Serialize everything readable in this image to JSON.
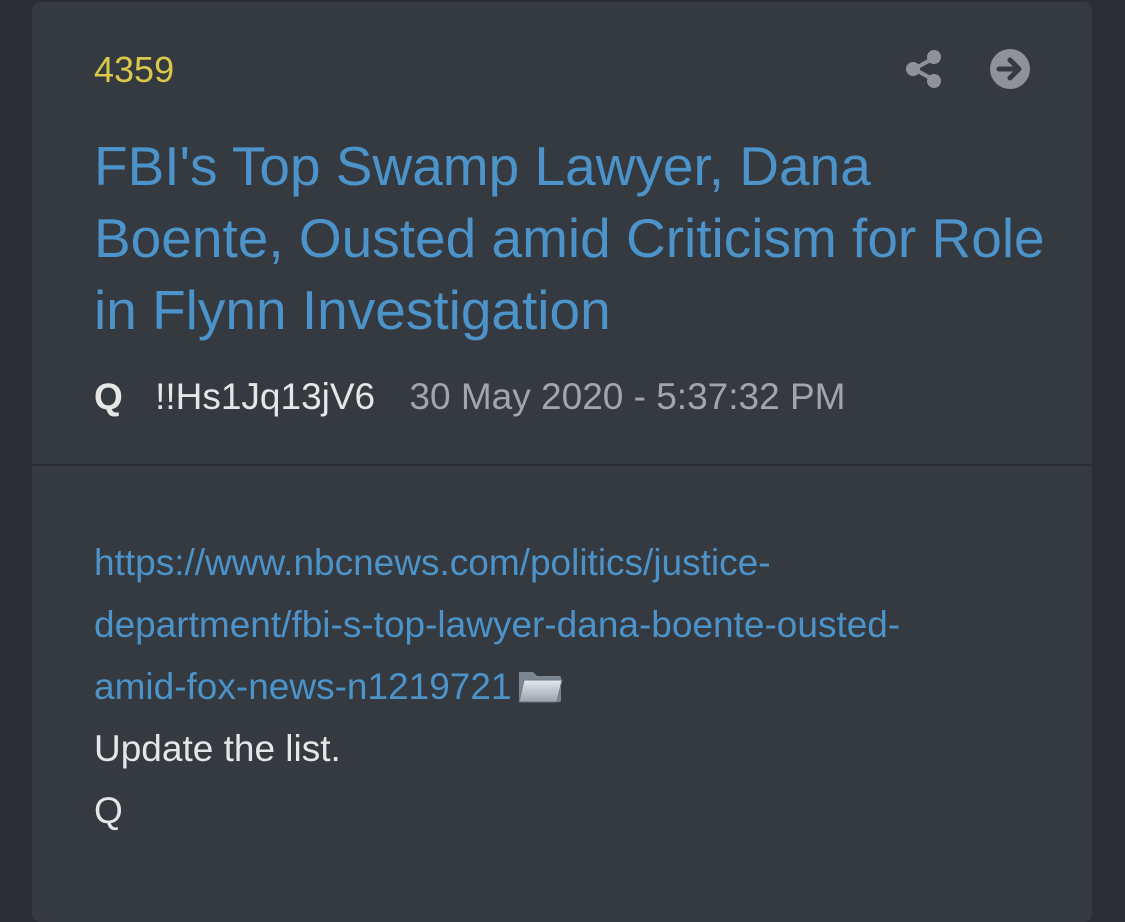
{
  "post": {
    "number": "4359",
    "title": "FBI's Top Swamp Lawyer, Dana Boente, Ousted amid Criticism for Role in Flynn Investigation",
    "author": "Q",
    "tripcode": "!!Hs1Jq13jV6",
    "timestamp": "30 May 2020 - 5:37:32 PM",
    "link_line1": "https://www.nbcnews.com/politics/justice-",
    "link_line2": "department/fbi-s-top-lawyer-dana-boente-ousted-",
    "link_line3": "amid-fox-news-n1219721",
    "body_line1": "Update the list.",
    "body_line2": "Q"
  },
  "icons": {
    "share": "share-icon",
    "goto": "arrow-right-circle-icon",
    "folder": "folder-icon"
  },
  "colors": {
    "background": "#2b2e33",
    "card": "#353940",
    "accent_link": "#4b93c9",
    "post_number": "#d8c94a",
    "text": "#e6e6e6",
    "muted": "#a2a6ab"
  }
}
